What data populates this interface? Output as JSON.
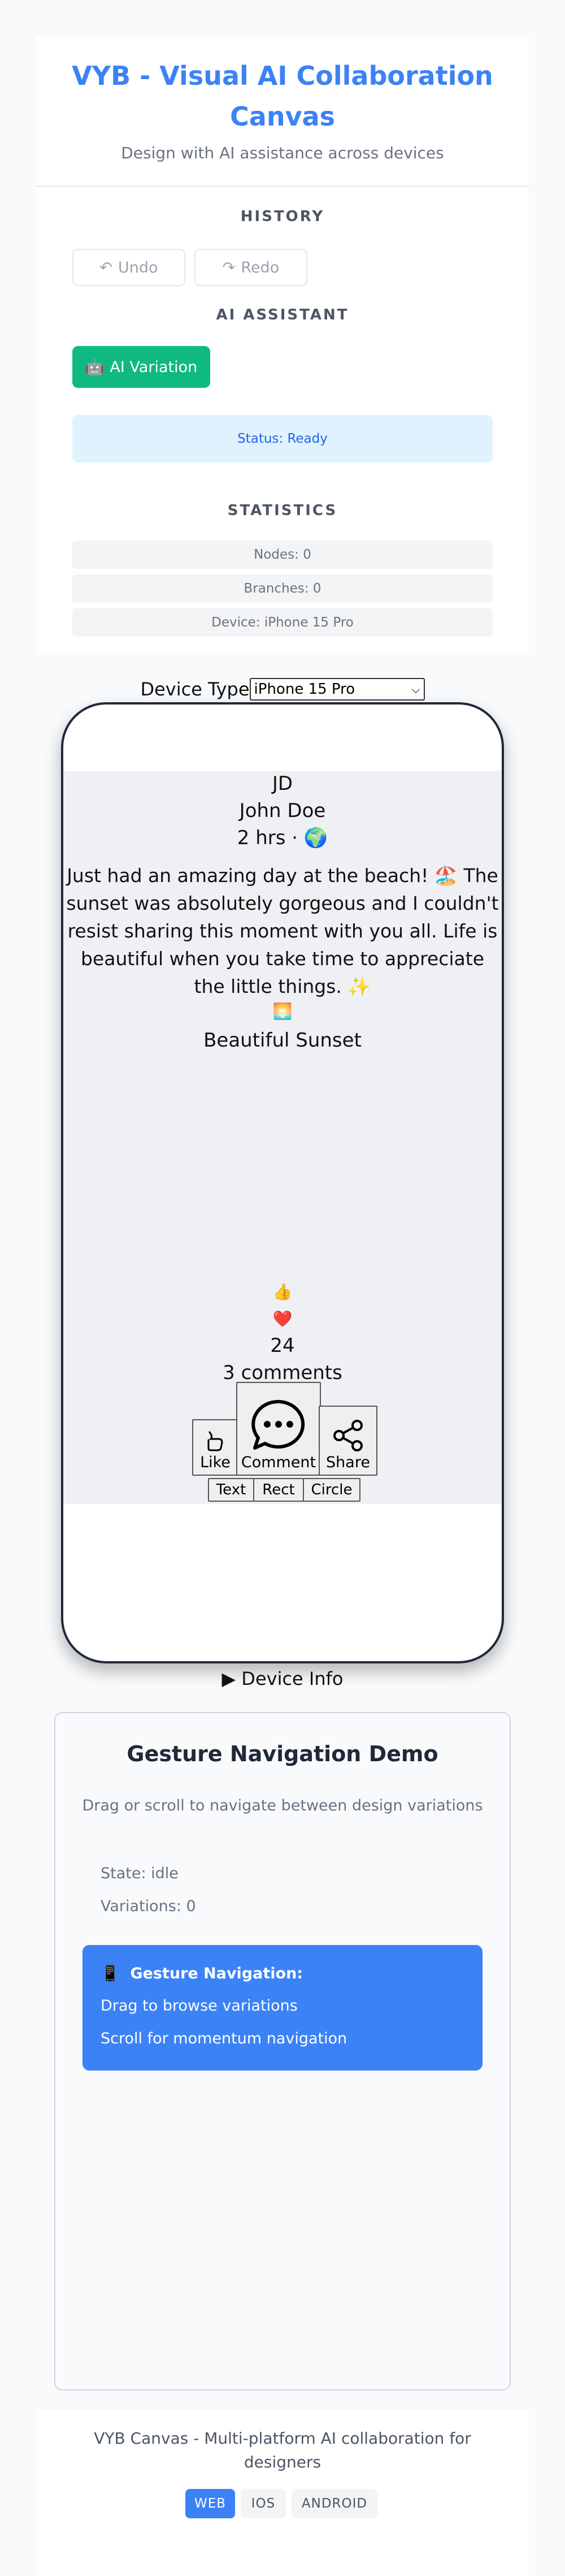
{
  "header": {
    "title": "VYB - Visual AI Collaboration Canvas",
    "subtitle": "Design with AI assistance across devices"
  },
  "toolbar": {
    "history_title": "HISTORY",
    "undo_label": "Undo",
    "redo_label": "Redo",
    "ai_title": "AI ASSISTANT",
    "ai_variation_label": "AI Variation",
    "status": "Status: Ready",
    "stats_title": "STATISTICS",
    "nodes": "Nodes: 0",
    "branches": "Branches: 0",
    "device": "Device: iPhone 15 Pro"
  },
  "device_selector": {
    "label": "Device Type",
    "selected": "iPhone 15 Pro"
  },
  "post": {
    "initials": "JD",
    "author": "John Doe",
    "meta": "2 hrs · 🌍",
    "text": "Just had an amazing day at the beach! 🏖️ The sunset was absolutely gorgeous and I couldn't resist sharing this moment with you all. Life is beautiful when you take time to appreciate the little things. ✨",
    "image_emoji": "🌅",
    "image_caption": "Beautiful Sunset",
    "reaction_like": "👍",
    "reaction_love": "❤️",
    "reaction_count": "24",
    "comments": "3 comments",
    "like_label": "Like",
    "comment_label": "Comment",
    "share_label": "Share"
  },
  "canvas_tools": [
    "Text",
    "Rect",
    "Circle"
  ],
  "device_info_label": "▶ Device Info",
  "gesture": {
    "title": "Gesture Navigation Demo",
    "description": "Drag or scroll to navigate between design variations",
    "state": "State: idle",
    "variations": "Variations: 0",
    "box_title": "Gesture Navigation:",
    "box_line1": "Drag to browse variations",
    "box_line2": "Scroll for momentum navigation"
  },
  "footer": {
    "text": "VYB Canvas - Multi-platform AI collaboration for designers",
    "platforms": [
      "WEB",
      "IOS",
      "ANDROID"
    ],
    "active_platform": "WEB"
  },
  "colors": {
    "accent": "#3b82f6",
    "ai_button": "#10b981",
    "status_bg": "#e0f2fe"
  }
}
